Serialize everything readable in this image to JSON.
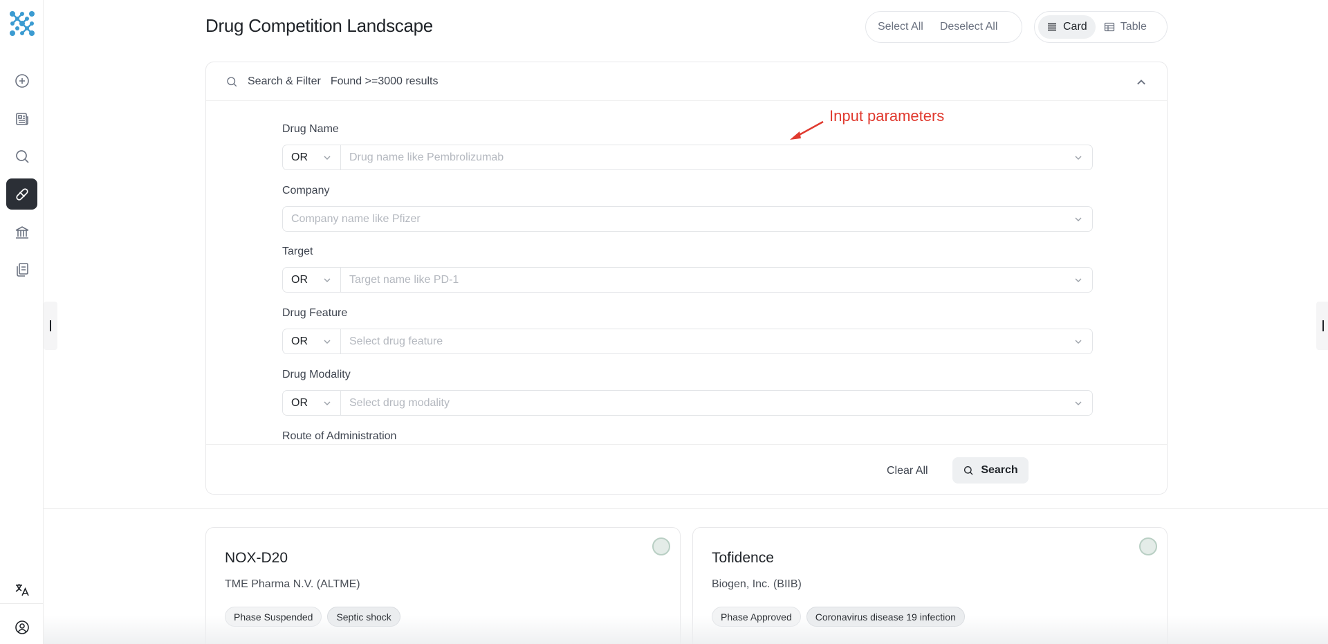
{
  "header": {
    "title": "Drug Competition Landscape",
    "select_all": "Select All",
    "deselect_all": "Deselect All",
    "view_card": "Card",
    "view_table": "Table",
    "active_view": "Card"
  },
  "sidebar": {
    "items": [
      {
        "name": "new",
        "icon": "plus-circle-icon",
        "active": false
      },
      {
        "name": "news",
        "icon": "newspaper-icon",
        "active": false
      },
      {
        "name": "search",
        "icon": "search-icon",
        "active": false
      },
      {
        "name": "drugs",
        "icon": "pill-icon",
        "active": true
      },
      {
        "name": "institutions",
        "icon": "bank-icon",
        "active": false
      },
      {
        "name": "documents",
        "icon": "copy-icon",
        "active": false
      }
    ],
    "bottom": [
      {
        "name": "language",
        "icon": "translate-icon"
      },
      {
        "name": "account",
        "icon": "user-circle-icon"
      }
    ]
  },
  "filter": {
    "title": "Search & Filter",
    "result_count": "Found >=3000 results",
    "annotation": "Input parameters",
    "fields": {
      "drug_name": {
        "label": "Drug Name",
        "operator": "OR",
        "placeholder": "Drug name like Pembrolizumab"
      },
      "company": {
        "label": "Company",
        "placeholder": "Company name like Pfizer"
      },
      "target": {
        "label": "Target",
        "operator": "OR",
        "placeholder": "Target name like PD-1"
      },
      "drug_feature": {
        "label": "Drug Feature",
        "operator": "OR",
        "placeholder": "Select drug feature"
      },
      "drug_modality": {
        "label": "Drug Modality",
        "operator": "OR",
        "placeholder": "Select drug modality"
      },
      "route": {
        "label": "Route of Administration"
      }
    },
    "clear_all": "Clear All",
    "search": "Search"
  },
  "cards": [
    {
      "name": "NOX-D20",
      "company": "TME Pharma N.V. (ALTME)",
      "phase": "Phase Suspended",
      "indication": "Septic shock"
    },
    {
      "name": "Tofidence",
      "company": "Biogen, Inc. (BIIB)",
      "phase": "Phase Approved",
      "indication": "Coronavirus disease 19 infection"
    }
  ],
  "colors": {
    "active_nav": "#2b2f36",
    "annotation": "#e03a2f",
    "logo": "#3b9bd1"
  }
}
